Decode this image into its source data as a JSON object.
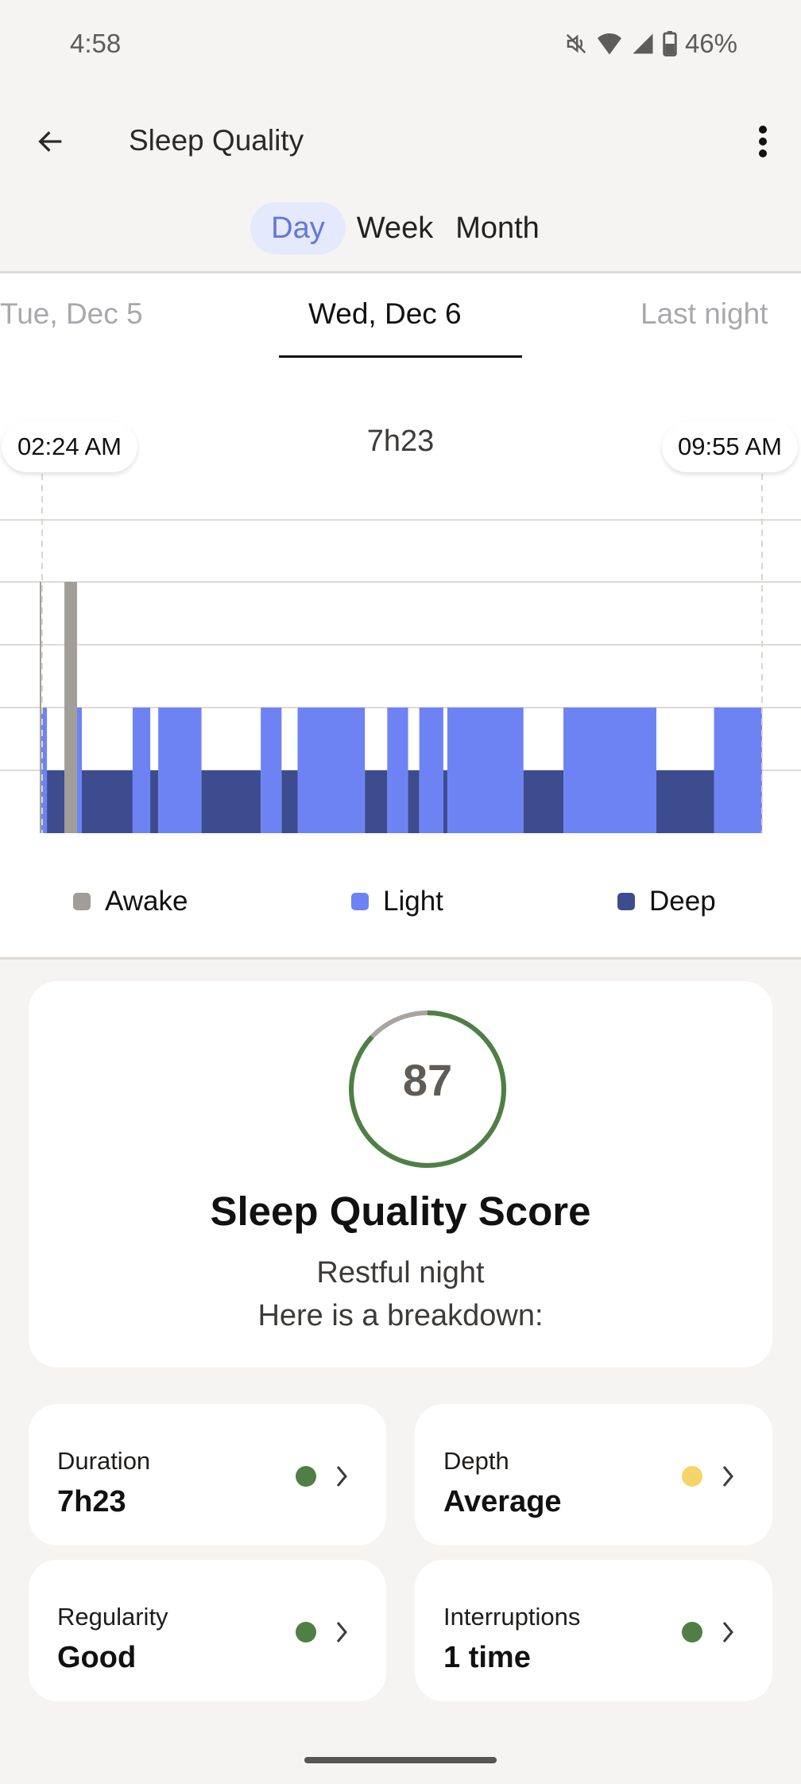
{
  "status_bar": {
    "time": "4:58",
    "battery": "46%",
    "icons": [
      "mute-icon",
      "wifi-icon",
      "signal-icon",
      "battery-icon"
    ]
  },
  "app_bar": {
    "title": "Sleep Quality",
    "back_icon": "back-arrow-icon",
    "menu_icon": "more-vert-icon"
  },
  "range_tabs": [
    {
      "label": "Day",
      "active": true
    },
    {
      "label": "Week",
      "active": false
    },
    {
      "label": "Month",
      "active": false
    }
  ],
  "date_tabs": [
    {
      "label": "Tue, Dec 5",
      "active": false
    },
    {
      "label": "Wed, Dec 6",
      "active": true
    },
    {
      "label": "Last night",
      "active": false
    }
  ],
  "colors": {
    "awake": "#a19e99",
    "light": "#6e83f3",
    "deep": "#3d4c8f",
    "good": "#4f7f45",
    "average": "#f5d56a",
    "ring_track": "#a8a5a0"
  },
  "chart_data": {
    "type": "bar",
    "title": "7h23",
    "start_label": "02:24 AM",
    "end_label": "09:55 AM",
    "x_unit": "minutes from sleep start",
    "xlim": [
      0,
      451
    ],
    "levels": [
      "Deep",
      "Light",
      "Awake"
    ],
    "legend": [
      {
        "name": "Awake",
        "color": "#a19e99"
      },
      {
        "name": "Light",
        "color": "#6e83f3"
      },
      {
        "name": "Deep",
        "color": "#3d4c8f"
      }
    ],
    "legend_position": "bottom",
    "grid": true,
    "segments": [
      {
        "stage": "Awake",
        "start": 0,
        "end": 1
      },
      {
        "stage": "Light",
        "start": 1,
        "end": 4.5
      },
      {
        "stage": "Deep",
        "start": 4.5,
        "end": 15.4
      },
      {
        "stage": "Awake",
        "start": 15.4,
        "end": 23.3
      },
      {
        "stage": "Light",
        "start": 23.3,
        "end": 26.3
      },
      {
        "stage": "Deep",
        "start": 26.3,
        "end": 58
      },
      {
        "stage": "Light",
        "start": 58,
        "end": 69
      },
      {
        "stage": "Deep",
        "start": 69,
        "end": 74
      },
      {
        "stage": "Light",
        "start": 74,
        "end": 101
      },
      {
        "stage": "Deep",
        "start": 101,
        "end": 138
      },
      {
        "stage": "Light",
        "start": 138,
        "end": 151
      },
      {
        "stage": "Deep",
        "start": 151,
        "end": 161
      },
      {
        "stage": "Light",
        "start": 161,
        "end": 203
      },
      {
        "stage": "Deep",
        "start": 203,
        "end": 217
      },
      {
        "stage": "Light",
        "start": 217,
        "end": 230
      },
      {
        "stage": "Deep",
        "start": 230,
        "end": 237
      },
      {
        "stage": "Light",
        "start": 237,
        "end": 252
      },
      {
        "stage": "Deep",
        "start": 252,
        "end": 254.5
      },
      {
        "stage": "Light",
        "start": 254.5,
        "end": 302
      },
      {
        "stage": "Deep",
        "start": 302,
        "end": 327
      },
      {
        "stage": "Light",
        "start": 327,
        "end": 385
      },
      {
        "stage": "Deep",
        "start": 385,
        "end": 421
      },
      {
        "stage": "Light",
        "start": 421,
        "end": 451
      }
    ]
  },
  "score": {
    "value": "87",
    "fraction": 0.87,
    "title": "Sleep Quality Score",
    "subtitle": "Restful night",
    "subtitle2": "Here is a breakdown:"
  },
  "metrics": [
    {
      "label": "Duration",
      "value": "7h23",
      "status": "good",
      "color": "#4f7f45"
    },
    {
      "label": "Depth",
      "value": "Average",
      "status": "average",
      "color": "#f5d56a"
    },
    {
      "label": "Regularity",
      "value": "Good",
      "status": "good",
      "color": "#4f7f45"
    },
    {
      "label": "Interruptions",
      "value": "1 time",
      "status": "good",
      "color": "#4f7f45"
    }
  ]
}
